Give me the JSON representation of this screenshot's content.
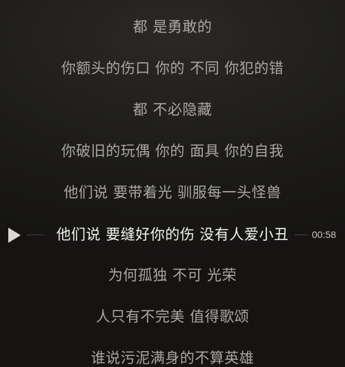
{
  "lyrics": {
    "lines": [
      "都 是勇敢的",
      "你额头的伤口 你的 不同 你犯的错",
      "都 不必隐藏",
      "你破旧的玩偶 你的 面具 你的自我",
      "他们说 要带着光 驯服每一头怪兽",
      "他们说 要缝好你的伤 没有人爱小丑",
      "为何孤独 不可 光荣",
      "人只有不完美 值得歌颂",
      "谁说污泥满身的不算英雄"
    ],
    "current_index": 5
  },
  "playback": {
    "play_icon": "play-triangle-icon",
    "timestamp": "00:58"
  },
  "colors": {
    "current_line": "#f2f2f0",
    "other_lines": "#a9a7a1",
    "timestamp": "#c9c7c2",
    "background": "#1f1e1b"
  }
}
